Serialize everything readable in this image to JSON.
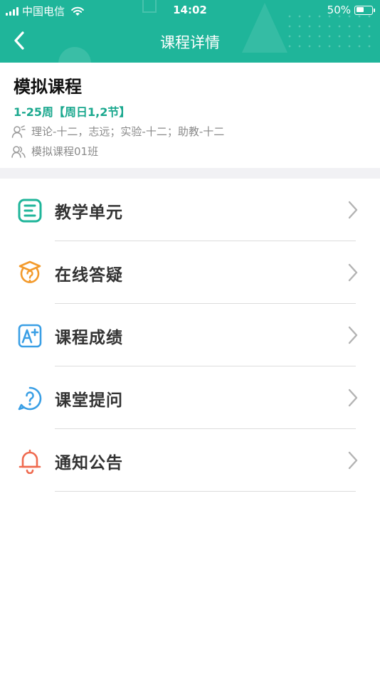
{
  "status_bar": {
    "carrier": "中国电信",
    "time": "14:02",
    "battery": "50%",
    "battery_level": 0.5
  },
  "nav": {
    "title": "课程详情",
    "back_icon": "chevron-left-icon"
  },
  "course": {
    "name": "模拟课程",
    "schedule": "1-25周【周日1,2节】",
    "teachers": "理论-十二，志远；实验-十二；助教-十二",
    "class_name": "模拟课程01班"
  },
  "menu": {
    "items": [
      {
        "label": "教学单元",
        "icon": "teaching-unit-icon",
        "color": "#1fb59a"
      },
      {
        "label": "在线答疑",
        "icon": "online-qa-icon",
        "color": "#f39a2b"
      },
      {
        "label": "课程成绩",
        "icon": "grade-icon",
        "color": "#3a9fe5"
      },
      {
        "label": "课堂提问",
        "icon": "question-icon",
        "color": "#3a9fe5"
      },
      {
        "label": "通知公告",
        "icon": "bell-icon",
        "color": "#ef6a4f"
      }
    ]
  },
  "colors": {
    "header": "#1fb59a",
    "accent_text": "#1aa88e",
    "band": "#f1f1f4"
  }
}
